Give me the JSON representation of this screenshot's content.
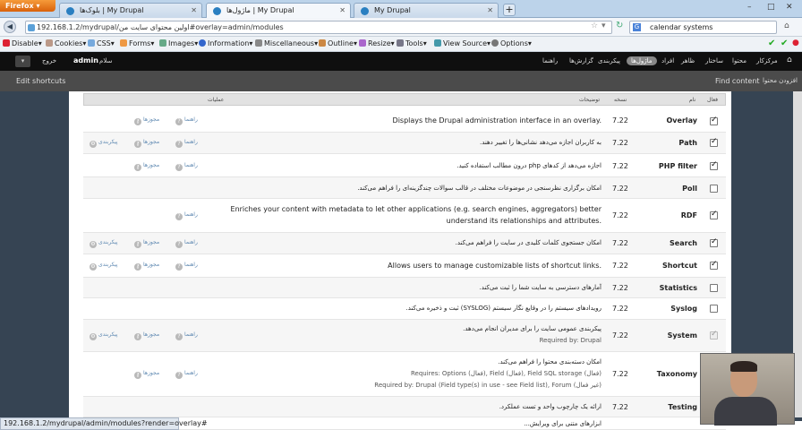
{
  "browser": {
    "firefox_label": "Firefox",
    "tabs": [
      {
        "title": "بلوک‌ها | My Drupal"
      },
      {
        "title": "ماژول‌ها | My Drupal"
      },
      {
        "title": "My Drupal"
      }
    ],
    "new_tab": "+",
    "url": "192.168.1.2/mydrupal/اولین محتوای سایت من#overlay=admin/modules",
    "search_engine_letter": "G",
    "search_value": "calendar systems",
    "window_controls": [
      "–",
      "□",
      "✕"
    ]
  },
  "devbar": {
    "items": [
      "Disable",
      "Cookies",
      "CSS",
      "Forms",
      "Images",
      "Information",
      "Miscellaneous",
      "Outline",
      "Resize",
      "Tools",
      "View Source",
      "Options"
    ]
  },
  "admin_toolbar": {
    "user": "admin",
    "hello": "سلام",
    "logout": "خروج",
    "menu": [
      "مرکزکار",
      "محتوا",
      "ساختار",
      "ظاهر",
      "افراد",
      "ماژول‌ها",
      "پیکربندی",
      "گزارش‌ها",
      "راهنما"
    ],
    "active_index": 5
  },
  "shortcuts": {
    "edit": "Edit shortcuts",
    "find_content": "Find content",
    "add_content": "افزودن محتوا"
  },
  "table": {
    "headers": {
      "enabled": "فعال",
      "name": "نام",
      "version": "نسخه",
      "description": "توضیحات",
      "operations": "عملیات"
    },
    "op_help": "راهنما",
    "op_perm": "مجوزها",
    "op_config": "پیکربندی",
    "rows": [
      {
        "name": "Overlay",
        "version": "7.22",
        "desc": "Displays the Drupal administration interface in an overlay.",
        "checked": true
      },
      {
        "name": "Path",
        "version": "7.22",
        "desc": "به کاربران اجازه می‌دهد نشانی‌ها را تغییر دهند.",
        "checked": true
      },
      {
        "name": "PHP filter",
        "version": "7.22",
        "desc": "اجازه می‌دهد از کدهای php درون مطالب استفاده کنید.",
        "checked": true
      },
      {
        "name": "Poll",
        "version": "7.22",
        "desc": "امکان برگزاری نظرسنجی در موضوعات مختلف در قالب سوالات چندگزینه‌ای را فراهم می‌کند.",
        "checked": false
      },
      {
        "name": "RDF",
        "version": "7.22",
        "desc": "Enriches your content with metadata to let other applications (e.g. search engines, aggregators) better",
        "desc2": "understand its relationships and attributes.",
        "checked": true
      },
      {
        "name": "Search",
        "version": "7.22",
        "desc": "امکان جستجوی کلمات کلیدی در سایت را فراهم می‌کند.",
        "checked": true
      },
      {
        "name": "Shortcut",
        "version": "7.22",
        "desc": "Allows users to manage customizable lists of shortcut links.",
        "checked": true
      },
      {
        "name": "Statistics",
        "version": "7.22",
        "desc": "آمارهای دسترسی به سایت شما را ثبت می‌کند.",
        "checked": false
      },
      {
        "name": "Syslog",
        "version": "7.22",
        "desc": "رویدادهای سیستم را در وقایع نگار سیستم (SYSLOG) ثبت و ذخیره می‌کند.",
        "checked": false
      },
      {
        "name": "System",
        "version": "7.22",
        "desc": "پیکربندی عمومی سایت را برای مدیران انجام می‌دهد.",
        "desc2": "Required by: Drupal",
        "checked": true
      },
      {
        "name": "Taxonomy",
        "version": "7.22",
        "desc": "امکان دسته‌بندی محتوا را فراهم می‌کند.",
        "desc2": "Requires: Options (فعال), Field (فعال), Field SQL storage (فعال)",
        "desc3": "Required by: Drupal (Field type(s) in use - see Field list), Forum (غیر فعال)",
        "checked": true
      },
      {
        "name": "Testing",
        "version": "7.22",
        "desc": "ارائه یک چارچوب واحد و تست عملکرد.",
        "checked": false
      }
    ],
    "partial_row": "ابزارهای متنی برای ویرایش..."
  },
  "statusbar": "192.168.1.2/mydrupal/admin/modules?render=overlay#"
}
